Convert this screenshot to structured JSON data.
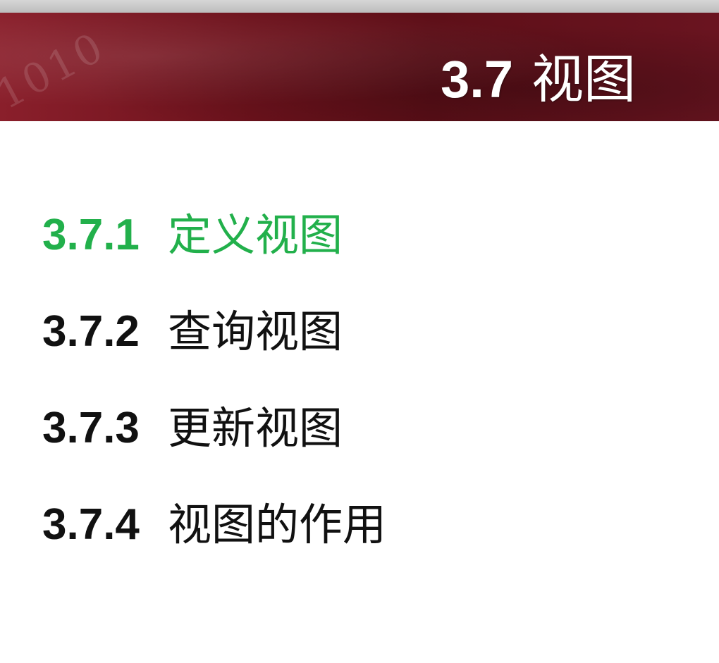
{
  "header": {
    "watermark": "1010",
    "section_number": "3.7",
    "section_title": "视图"
  },
  "toc": [
    {
      "number": "3.7.1",
      "label": "定义视图",
      "highlighted": true,
      "color": "#22b04b"
    },
    {
      "number": "3.7.2",
      "label": "查询视图",
      "highlighted": false,
      "color": "#111111"
    },
    {
      "number": "3.7.3",
      "label": "更新视图",
      "highlighted": false,
      "color": "#111111"
    },
    {
      "number": "3.7.4",
      "label": "视图的作用",
      "highlighted": false,
      "color": "#111111"
    }
  ],
  "colors": {
    "banner": "#6d121c",
    "accent": "#22b04b",
    "text": "#111111"
  }
}
